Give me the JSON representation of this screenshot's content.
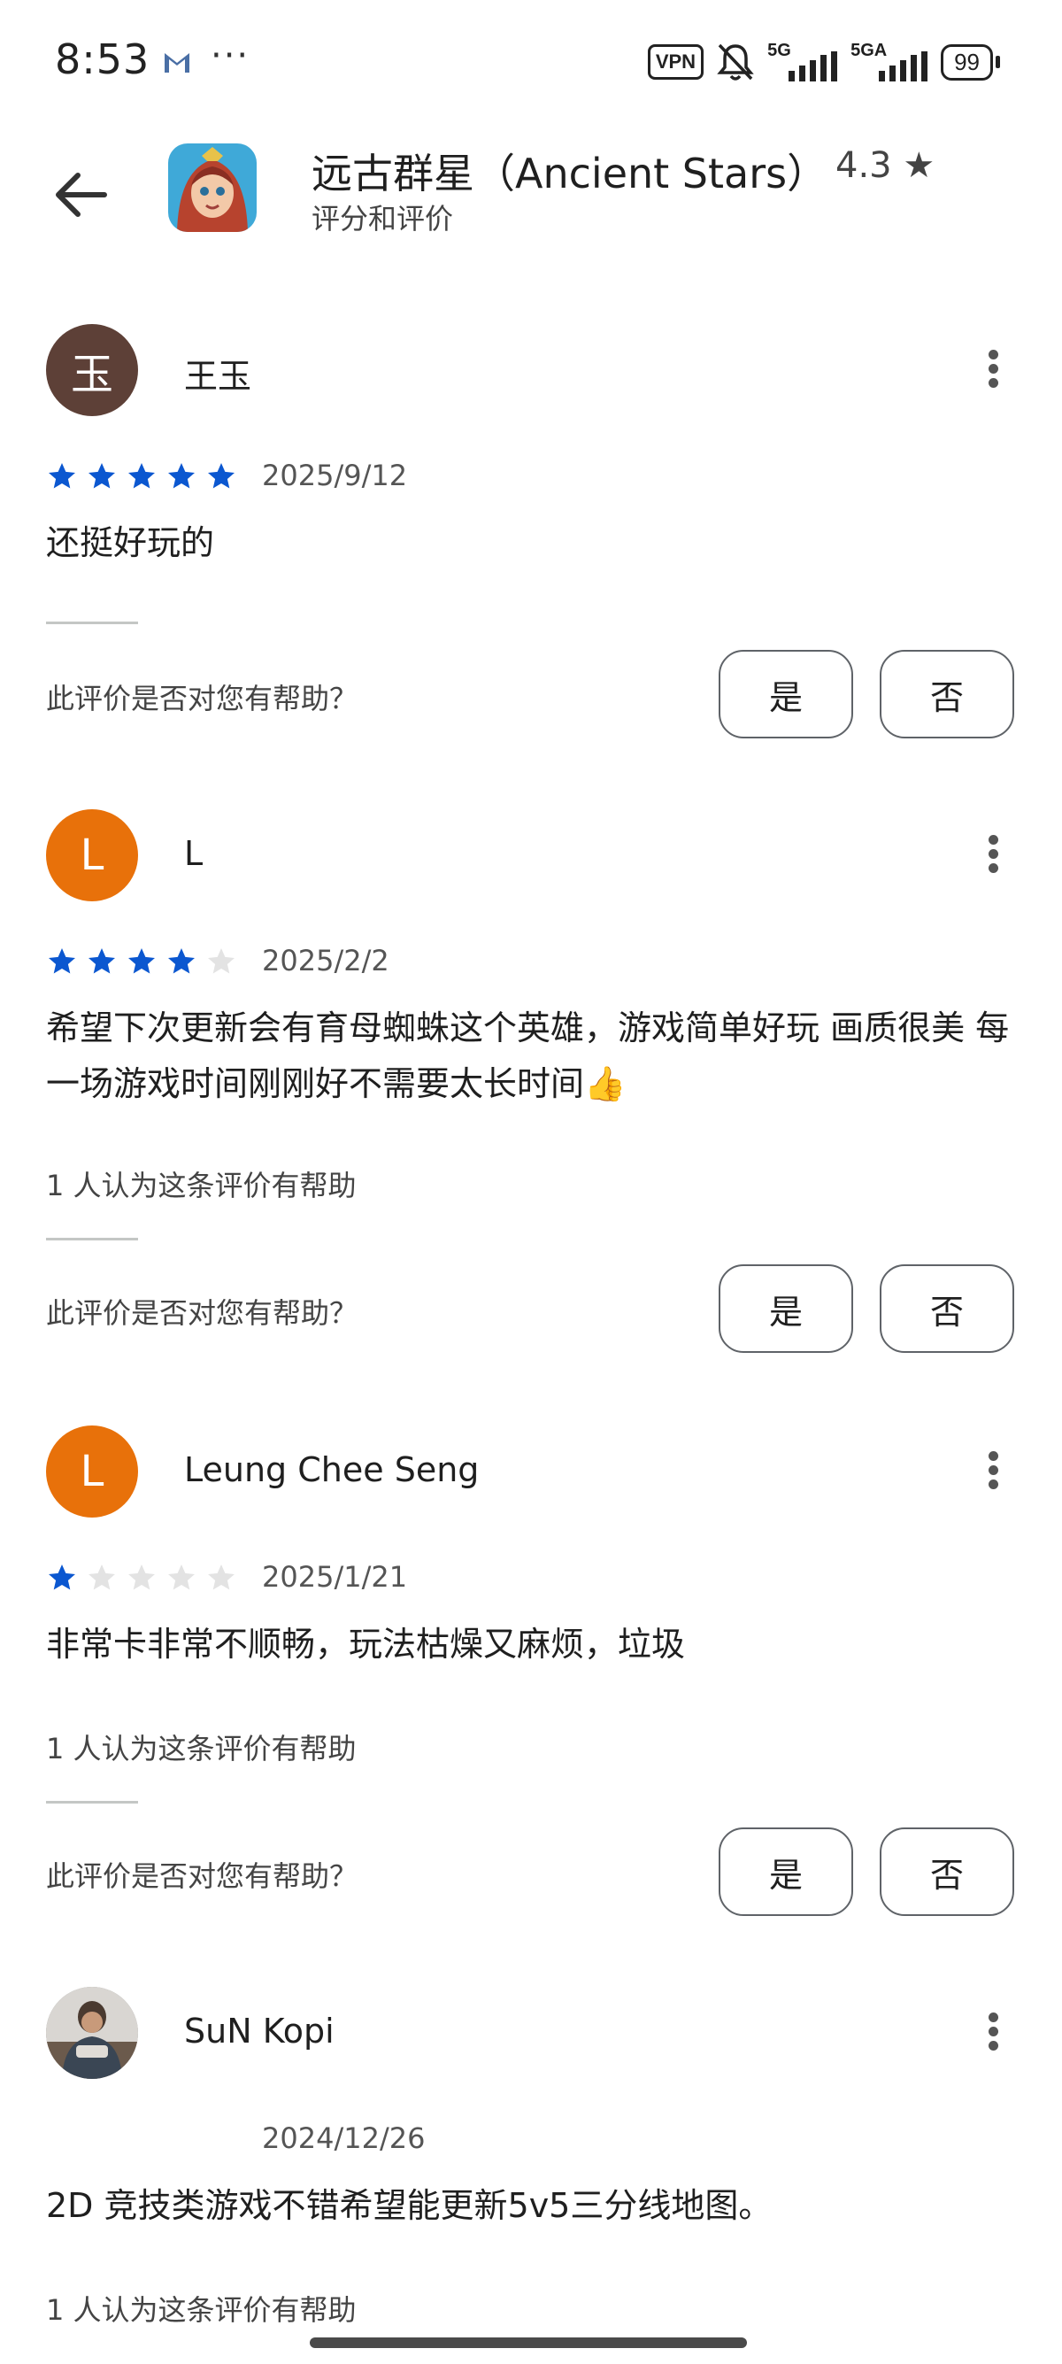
{
  "status_bar": {
    "time": "8:53",
    "icons": [
      "gmail-icon",
      "more-dots-icon",
      "vpn-icon",
      "mute-bell-icon",
      "signal-5g-icon",
      "signal-5ga-icon",
      "battery-icon"
    ],
    "more": "···",
    "vpn": "VPN",
    "net1": "5G",
    "net2": "5GA",
    "battery": "99"
  },
  "header": {
    "app_name": "远古群星（Ancient Stars）",
    "rating": "4.3 ★",
    "subtitle": "评分和评价"
  },
  "colors": {
    "star_filled": "#0b57d0",
    "star_empty": "#e3e3e3",
    "avatar_brown": "#5d4037",
    "avatar_orange": "#e8710a"
  },
  "helpful_question": "此评价是否对您有帮助？",
  "vote_yes": "是",
  "vote_no": "否",
  "reviews": [
    {
      "avatar_letter": "玉",
      "name": "王玉",
      "rating": 5,
      "date": "2025/9/12",
      "text": "还挺好玩的",
      "helpful_count": ""
    },
    {
      "avatar_letter": "L",
      "name": "L",
      "rating": 4,
      "date": "2025/2/2",
      "text": "希望下次更新会有育母蜘蛛这个英雄，游戏简单好玩 画质很美 每一场游戏时间刚刚好不需要太长时间👍",
      "helpful_count": "1 人认为这条评价有帮助"
    },
    {
      "avatar_letter": "L",
      "name": "Leung Chee Seng",
      "rating": 1,
      "date": "2025/1/21",
      "text": "非常卡非常不顺畅，玩法枯燥又麻烦，垃圾",
      "helpful_count": "1 人认为这条评价有帮助"
    },
    {
      "avatar_letter": "",
      "name": "SuN Kopi",
      "rating": 0,
      "date": "2024/12/26",
      "text": "2D 竞技类游戏不错希望能更新5v5三分线地图。",
      "helpful_count": "1 人认为这条评价有帮助"
    }
  ]
}
